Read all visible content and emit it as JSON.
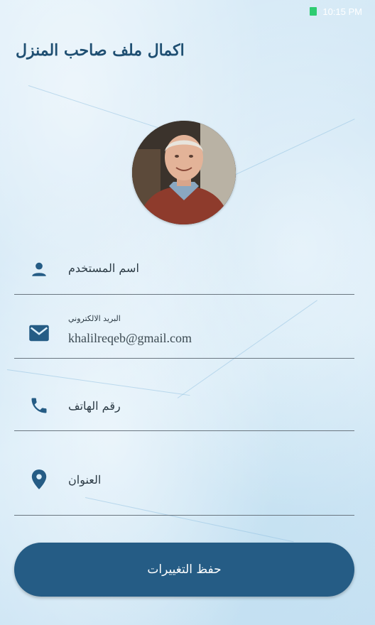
{
  "status_bar": {
    "time": "10:15 PM",
    "battery_color": "#2ecc71"
  },
  "page": {
    "title": "اكمال ملف صاحب المنزل"
  },
  "profile": {
    "avatar_desc": "profile-photo"
  },
  "form": {
    "username": {
      "label": "اسم المستخدم",
      "value": "",
      "icon": "person-icon"
    },
    "email": {
      "label": "البريد الالكتروني",
      "value": "khalilreqeb@gmail.com",
      "icon": "email-icon"
    },
    "phone": {
      "label": "رقم الهاتف",
      "value": "",
      "icon": "phone-icon"
    },
    "address": {
      "label": "العنوان",
      "value": "",
      "icon": "location-pin-icon"
    }
  },
  "actions": {
    "save_label": "حفظ التغييرات"
  },
  "colors": {
    "accent": "#255c85",
    "title": "#1f4f72",
    "icon": "#255c85"
  }
}
